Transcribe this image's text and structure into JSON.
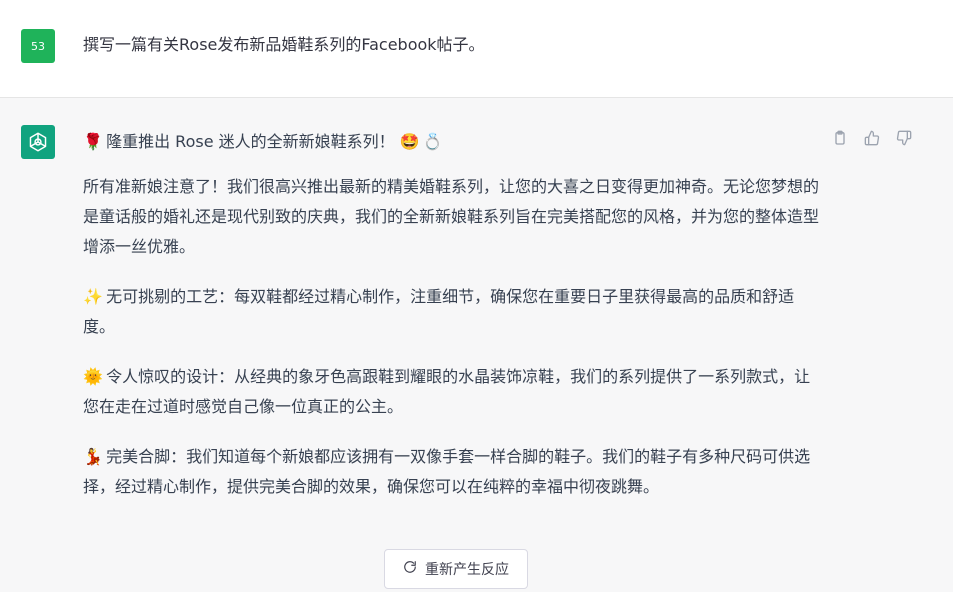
{
  "user": {
    "avatar_text": "53",
    "message": "撰写一篇有关Rose发布新品婚鞋系列的Facebook帖子。"
  },
  "assistant": {
    "icons": [
      "rose-icon",
      "star-struck-icon",
      "ring-icon",
      "sparkles-icon",
      "sun-icon",
      "dancer-icon"
    ],
    "title": {
      "emoji_start": "🌹",
      "text": "隆重推出 Rose 迷人的全新新娘鞋系列！",
      "emoji_end_1": "🤩",
      "emoji_end_2": "💍"
    },
    "paragraphs": [
      {
        "emoji": "",
        "text": "所有准新娘注意了！我们很高兴推出最新的精美婚鞋系列，让您的大喜之日变得更加神奇。无论您梦想的是童话般的婚礼还是现代别致的庆典，我们的全新新娘鞋系列旨在完美搭配您的风格，并为您的整体造型增添一丝优雅。"
      },
      {
        "emoji": "✨",
        "text": "无可挑剔的工艺：每双鞋都经过精心制作，注重细节，确保您在重要日子里获得最高的品质和舒适度。"
      },
      {
        "emoji": "🌞",
        "text": "令人惊叹的设计：从经典的象牙色高跟鞋到耀眼的水晶装饰凉鞋，我们的系列提供了一系列款式，让您在走在过道时感觉自己像一位真正的公主。"
      },
      {
        "emoji": "💃",
        "text": "完美合脚：我们知道每个新娘都应该拥有一双像手套一样合脚的鞋子。我们的鞋子有多种尺码可供选择，经过精心制作，提供完美合脚的效果，确保您可以在纯粹的幸福中彻夜跳舞。"
      }
    ]
  },
  "actions": {
    "icons": [
      "clipboard-icon",
      "thumbs-up-icon",
      "thumbs-down-icon"
    ]
  },
  "regenerate": {
    "label": "重新产生反应",
    "icon": "refresh-icon"
  },
  "colors": {
    "user_avatar": "#1fb35a",
    "gpt_avatar": "#10a37f",
    "assistant_bg": "#f7f7f8"
  }
}
